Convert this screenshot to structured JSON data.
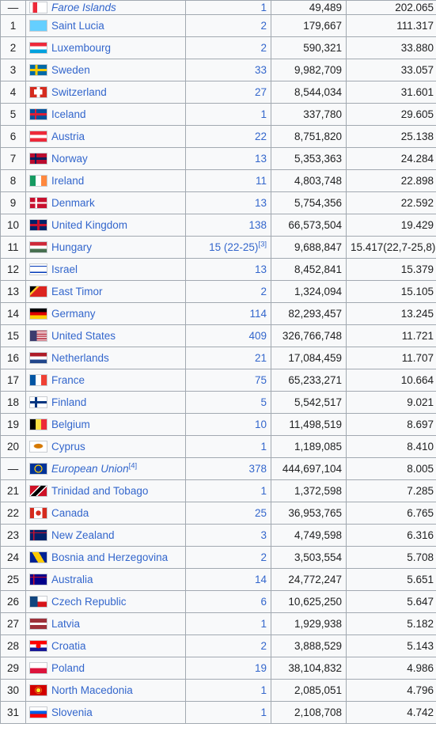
{
  "rows": [
    {
      "rank": "—",
      "name": "Faroe Islands",
      "italic": true,
      "count": "1",
      "count_sup": "",
      "pop": "49,489",
      "rate": "202.065",
      "flag": "linear-gradient(90deg,transparent 24%,#0065bd 24%,#0065bd 36%,transparent 36%),linear-gradient(180deg,#fff 38%,#0065bd 38%,#0065bd 62%,#fff 62%)",
      "flag_extra": "linear-gradient(90deg,#fff 17%,#ed2939 17%,#ed2939 43%,#fff 43%)"
    },
    {
      "rank": "1",
      "name": "Saint Lucia",
      "count": "2",
      "count_sup": "",
      "pop": "179,667",
      "rate": "111.317",
      "flag": "linear-gradient(135deg,#65cfff 0%,#65cfff 100%)"
    },
    {
      "rank": "2",
      "name": "Luxembourg",
      "count": "2",
      "count_sup": "",
      "pop": "590,321",
      "rate": "33.880",
      "flag": "linear-gradient(180deg,#ed2939 33%,#fff 33%,#fff 67%,#00a1de 67%)"
    },
    {
      "rank": "3",
      "name": "Sweden",
      "count": "33",
      "count_sup": "",
      "pop": "9,982,709",
      "rate": "33.057",
      "flag": "linear-gradient(90deg,transparent 30%,#fecc00 30%,#fecc00 45%,transparent 45%),linear-gradient(180deg,#006aa7 40%,#fecc00 40%,#fecc00 60%,#006aa7 60%)"
    },
    {
      "rank": "4",
      "name": "Switzerland",
      "count": "27",
      "count_sup": "",
      "pop": "8,544,034",
      "rate": "31.601",
      "flag": "linear-gradient(90deg,transparent 40%,#fff 40%,#fff 60%,transparent 60%),linear-gradient(180deg,#d52b1e 25%,transparent 25%,transparent 75%,#d52b1e 75%),linear-gradient(90deg,#d52b1e 25%,#fff 25%,#fff 75%,#d52b1e 75%)"
    },
    {
      "rank": "5",
      "name": "Iceland",
      "count": "1",
      "count_sup": "",
      "pop": "337,780",
      "rate": "29.605",
      "flag": "linear-gradient(90deg,transparent 28%,#dc1e35 28%,#dc1e35 38%,transparent 38%),linear-gradient(180deg,#02529c 38%,#dc1e35 38%,#dc1e35 62%,#02529c 62%)"
    },
    {
      "rank": "6",
      "name": "Austria",
      "count": "22",
      "count_sup": "",
      "pop": "8,751,820",
      "rate": "25.138",
      "flag": "linear-gradient(180deg,#ed2939 33%,#fff 33%,#fff 67%,#ed2939 67%)"
    },
    {
      "rank": "7",
      "name": "Norway",
      "count": "13",
      "count_sup": "",
      "pop": "5,353,363",
      "rate": "24.284",
      "flag": "linear-gradient(90deg,transparent 28%,#00205b 28%,#00205b 38%,transparent 38%),linear-gradient(180deg,#ba0c2f 38%,#00205b 38%,#00205b 62%,#ba0c2f 62%)"
    },
    {
      "rank": "8",
      "name": "Ireland",
      "count": "11",
      "count_sup": "",
      "pop": "4,803,748",
      "rate": "22.898",
      "flag": "linear-gradient(90deg,#169b62 33%,#fff 33%,#fff 67%,#ff883e 67%)"
    },
    {
      "rank": "9",
      "name": "Denmark",
      "count": "13",
      "count_sup": "",
      "pop": "5,754,356",
      "rate": "22.592",
      "flag": "linear-gradient(90deg,transparent 30%,#fff 30%,#fff 42%,transparent 42%),linear-gradient(180deg,#c8102e 42%,#fff 42%,#fff 58%,#c8102e 58%)"
    },
    {
      "rank": "10",
      "name": "United Kingdom",
      "count": "138",
      "count_sup": "",
      "pop": "66,573,504",
      "rate": "19.429",
      "flag": "linear-gradient(90deg,transparent 43%,#c8102e 43%,#c8102e 57%,transparent 57%),linear-gradient(180deg,#012169 40%,#c8102e 40%,#c8102e 60%,#012169 60%)"
    },
    {
      "rank": "11",
      "name": "Hungary",
      "count": "15 (22-25)",
      "count_sup": "[3]",
      "count_plain": true,
      "pop": "9,688,847",
      "rate": "15.417(22,7-25,8)",
      "flag": "linear-gradient(180deg,#ce2939 33%,#fff 33%,#fff 67%,#477050 67%)"
    },
    {
      "rank": "12",
      "name": "Israel",
      "count": "13",
      "count_sup": "",
      "pop": "8,452,841",
      "rate": "15.379",
      "flag": "linear-gradient(180deg,#fff 15%,#0038b8 15%,#0038b8 25%,#fff 25%,#fff 75%,#0038b8 75%,#0038b8 85%,#fff 85%)"
    },
    {
      "rank": "13",
      "name": "East Timor",
      "count": "2",
      "count_sup": "",
      "pop": "1,324,094",
      "rate": "15.105",
      "flag": "linear-gradient(135deg,#000 0%,#000 25%,#ffc726 25%,#ffc726 35%,#dc241f 35%)"
    },
    {
      "rank": "14",
      "name": "Germany",
      "count": "114",
      "count_sup": "",
      "pop": "82,293,457",
      "rate": "13.245",
      "flag": "linear-gradient(180deg,#000 33%,#dd0000 33%,#dd0000 67%,#ffce00 67%)"
    },
    {
      "rank": "15",
      "name": "United States",
      "count": "409",
      "count_sup": "",
      "pop": "326,766,748",
      "rate": "11.721",
      "flag": "linear-gradient(90deg,#3c3b6e 40%,transparent 40%),repeating-linear-gradient(180deg,#b22234 0,#b22234 1.2px,#fff 1.2px,#fff 2.3px)",
      "flag_clip": true
    },
    {
      "rank": "16",
      "name": "Netherlands",
      "count": "21",
      "count_sup": "",
      "pop": "17,084,459",
      "rate": "11.707",
      "flag": "linear-gradient(180deg,#ae1c28 33%,#fff 33%,#fff 67%,#21468b 67%)"
    },
    {
      "rank": "17",
      "name": "France",
      "count": "75",
      "count_sup": "",
      "pop": "65,233,271",
      "rate": "10.664",
      "flag": "linear-gradient(90deg,#0055a4 33%,#fff 33%,#fff 67%,#ef4135 67%)"
    },
    {
      "rank": "18",
      "name": "Finland",
      "count": "5",
      "count_sup": "",
      "pop": "5,542,517",
      "rate": "9.021",
      "flag": "linear-gradient(90deg,transparent 28%,#003580 28%,#003580 42%,transparent 42%),linear-gradient(180deg,#fff 38%,#003580 38%,#003580 62%,#fff 62%)"
    },
    {
      "rank": "19",
      "name": "Belgium",
      "count": "10",
      "count_sup": "",
      "pop": "11,498,519",
      "rate": "8.697",
      "flag": "linear-gradient(90deg,#000 33%,#fae042 33%,#fae042 67%,#ed2939 67%)"
    },
    {
      "rank": "20",
      "name": "Cyprus",
      "count": "1",
      "count_sup": "",
      "pop": "1,189,085",
      "rate": "8.410",
      "flag": "radial-gradient(ellipse 30% 25% at 50% 45%,#d57800 80%,#fff 100%)"
    },
    {
      "rank": "—",
      "name": "European Union",
      "italic": true,
      "name_sup": "[4]",
      "count": "378",
      "count_sup": "",
      "pop": "444,697,104",
      "rate": "8.005",
      "flag": "radial-gradient(circle at 50% 50%,#003399 30%,#ffcc00 32%,#ffcc00 40%,#003399 42%)"
    },
    {
      "rank": "21",
      "name": "Trinidad and Tobago",
      "count": "1",
      "count_sup": "",
      "pop": "1,372,598",
      "rate": "7.285",
      "flag": "linear-gradient(135deg,#ce1126 35%,#fff 35%,#fff 40%,#000 40%,#000 60%,#fff 60%,#fff 65%,#ce1126 65%)"
    },
    {
      "rank": "22",
      "name": "Canada",
      "count": "25",
      "count_sup": "",
      "pop": "36,953,765",
      "rate": "6.765",
      "flag": "linear-gradient(90deg,#d52b1e 25%,#fff 25%,#fff 75%,#d52b1e 75%)",
      "flag_extra": "radial-gradient(circle at 50% 50%,#d52b1e 25%,transparent 27%)"
    },
    {
      "rank": "23",
      "name": "New Zealand",
      "count": "3",
      "count_sup": "",
      "pop": "4,749,598",
      "rate": "6.316",
      "flag": "linear-gradient(90deg,transparent 20%,#c8102e 20%,#c8102e 27%,transparent 27%),linear-gradient(180deg,#012169 25%,#c8102e 25%,#c8102e 32%,#012169 32%)"
    },
    {
      "rank": "24",
      "name": "Bosnia and Herzegovina",
      "count": "2",
      "count_sup": "",
      "pop": "3,503,554",
      "rate": "5.708",
      "flag": "linear-gradient(60deg,#002395 35%,#fecb00 35%,#fecb00 65%,#002395 65%)"
    },
    {
      "rank": "25",
      "name": "Australia",
      "count": "14",
      "count_sup": "",
      "pop": "24,772,247",
      "rate": "5.651",
      "flag": "linear-gradient(90deg,transparent 20%,#c8102e 20%,#c8102e 27%,transparent 27%),linear-gradient(180deg,#00008b 25%,#c8102e 25%,#c8102e 32%,#00008b 32%)"
    },
    {
      "rank": "26",
      "name": "Czech Republic",
      "count": "6",
      "count_sup": "",
      "pop": "10,625,250",
      "rate": "5.647",
      "flag": "linear-gradient(180deg,#fff 50%,#d7141a 50%)",
      "flag_extra": "linear-gradient(90deg,#11457e 45%,transparent 45%)"
    },
    {
      "rank": "27",
      "name": "Latvia",
      "count": "1",
      "count_sup": "",
      "pop": "1,929,938",
      "rate": "5.182",
      "flag": "linear-gradient(180deg,#9e3039 40%,#fff 40%,#fff 60%,#9e3039 60%)"
    },
    {
      "rank": "28",
      "name": "Croatia",
      "count": "2",
      "count_sup": "",
      "pop": "3,888,529",
      "rate": "5.143",
      "flag": "radial-gradient(ellipse 20% 30% at 50% 50%,#ff0000 70%,transparent 75%),linear-gradient(180deg,#ff0000 33%,#fff 33%,#fff 67%,#171796 67%)"
    },
    {
      "rank": "29",
      "name": "Poland",
      "count": "19",
      "count_sup": "",
      "pop": "38,104,832",
      "rate": "4.986",
      "flag": "linear-gradient(180deg,#fff 50%,#dc143c 50%)"
    },
    {
      "rank": "30",
      "name": "North Macedonia",
      "count": "1",
      "count_sup": "",
      "pop": "2,085,051",
      "rate": "4.796",
      "flag": "radial-gradient(circle at 50% 50%,#f8e92e 20%,#d20000 22%,#d20000 30%,#f8e92e 30%,#f8e92e 34%,#d20000 34%)"
    },
    {
      "rank": "31",
      "name": "Slovenia",
      "count": "1",
      "count_sup": "",
      "pop": "2,108,708",
      "rate": "4.742",
      "flag": "linear-gradient(180deg,#fff 33%,#005ce5 33%,#005ce5 67%,#ff0000 67%)"
    }
  ]
}
